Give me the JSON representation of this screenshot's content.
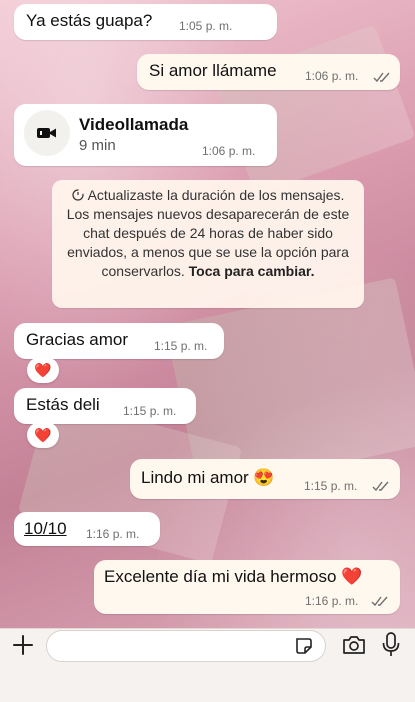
{
  "messages": [
    {
      "text": "Ya estás guapa?",
      "time": "1:05 p. m.",
      "direction": "in"
    },
    {
      "text": "Si amor llámame",
      "time": "1:06 p. m.",
      "direction": "out",
      "status": "read"
    },
    {
      "title": "Videollamada",
      "duration": "9 min",
      "time": "1:06 p. m.",
      "direction": "in",
      "icon": "video-camera-icon"
    },
    {
      "text": "Gracias amor",
      "time": "1:15 p. m.",
      "direction": "in",
      "reaction": "❤️"
    },
    {
      "text": "Estás deli",
      "time": "1:15 p. m.",
      "direction": "in",
      "reaction": "❤️"
    },
    {
      "text": "Lindo mi amor 😍",
      "time": "1:15 p. m.",
      "direction": "out",
      "status": "read"
    },
    {
      "text": "10/10",
      "time": "1:16 p. m.",
      "direction": "in"
    },
    {
      "text": "Excelente día mi vida hermoso ❤️",
      "time": "1:16 p. m.",
      "direction": "out",
      "status": "read"
    }
  ],
  "system_notice": {
    "icon": "timer-icon",
    "text": "Actualizaste la duración de los mensajes. Los mensajes nuevos desaparecerán de este chat después de 24 horas de haber sido enviados, a menos que se use la opción para conservarlos.",
    "action": "Toca para cambiar."
  },
  "composer": {
    "icons": [
      "plus-icon",
      "sticker-icon",
      "camera-icon",
      "microphone-icon"
    ]
  },
  "colors": {
    "incoming_bubble": "#ffffff",
    "outgoing_bubble": "#fff8ef",
    "read_ticks": "#53bdeb"
  }
}
